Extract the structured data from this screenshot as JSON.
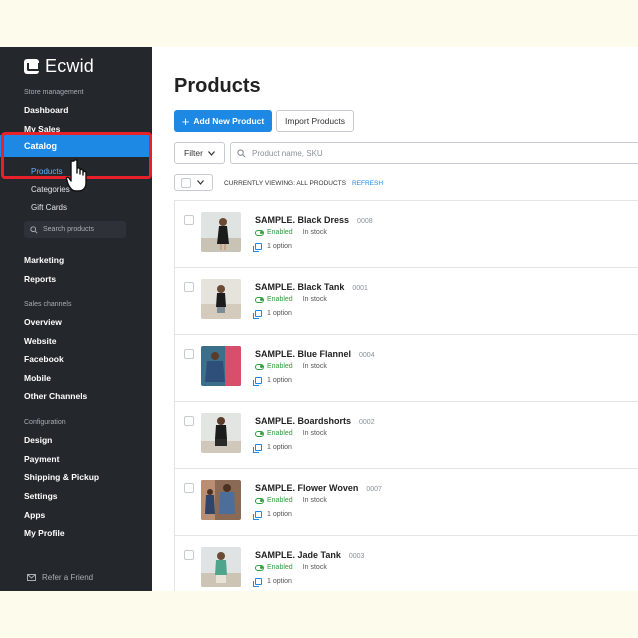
{
  "brand": {
    "name": "Ecwid",
    "accent": "#1e88e5",
    "sidebar_bg": "#24272c",
    "highlight": "#e8202a"
  },
  "sidebar": {
    "section_store": "Store management",
    "dashboard": "Dashboard",
    "my_sales": "My Sales",
    "catalog": "Catalog",
    "catalog_sub": [
      "Products",
      "Categories",
      "Gift Cards"
    ],
    "search_placeholder": "Search products",
    "marketing": "Marketing",
    "reports": "Reports",
    "section_channels": "Sales channels",
    "channels": [
      "Overview",
      "Website",
      "Facebook",
      "Mobile",
      "Other Channels"
    ],
    "section_config": "Configuration",
    "config": [
      "Design",
      "Payment",
      "Shipping & Pickup",
      "Settings",
      "Apps",
      "My Profile"
    ],
    "refer": "Refer a Friend"
  },
  "main": {
    "title": "Products",
    "add_button": "Add New Product",
    "import_button": "Import Products",
    "filter_button": "Filter",
    "search_placeholder": "Product name, SKU",
    "viewing_label": "CURRENTLY VIEWING: ALL PRODUCTS",
    "refresh_label": "REFRESH"
  },
  "products": [
    {
      "name": "SAMPLE. Black Dress",
      "sku": "0008",
      "status": "Enabled",
      "stock": "In stock",
      "options": "1 option"
    },
    {
      "name": "SAMPLE. Black Tank",
      "sku": "0001",
      "status": "Enabled",
      "stock": "In stock",
      "options": "1 option"
    },
    {
      "name": "SAMPLE. Blue Flannel",
      "sku": "0004",
      "status": "Enabled",
      "stock": "In stock",
      "options": "1 option"
    },
    {
      "name": "SAMPLE. Boardshorts",
      "sku": "0002",
      "status": "Enabled",
      "stock": "In stock",
      "options": "1 option"
    },
    {
      "name": "SAMPLE. Flower Woven",
      "sku": "0007",
      "status": "Enabled",
      "stock": "In stock",
      "options": "1 option"
    },
    {
      "name": "SAMPLE. Jade Tank",
      "sku": "0003",
      "status": "Enabled",
      "stock": "In stock",
      "options": "1 option"
    }
  ]
}
